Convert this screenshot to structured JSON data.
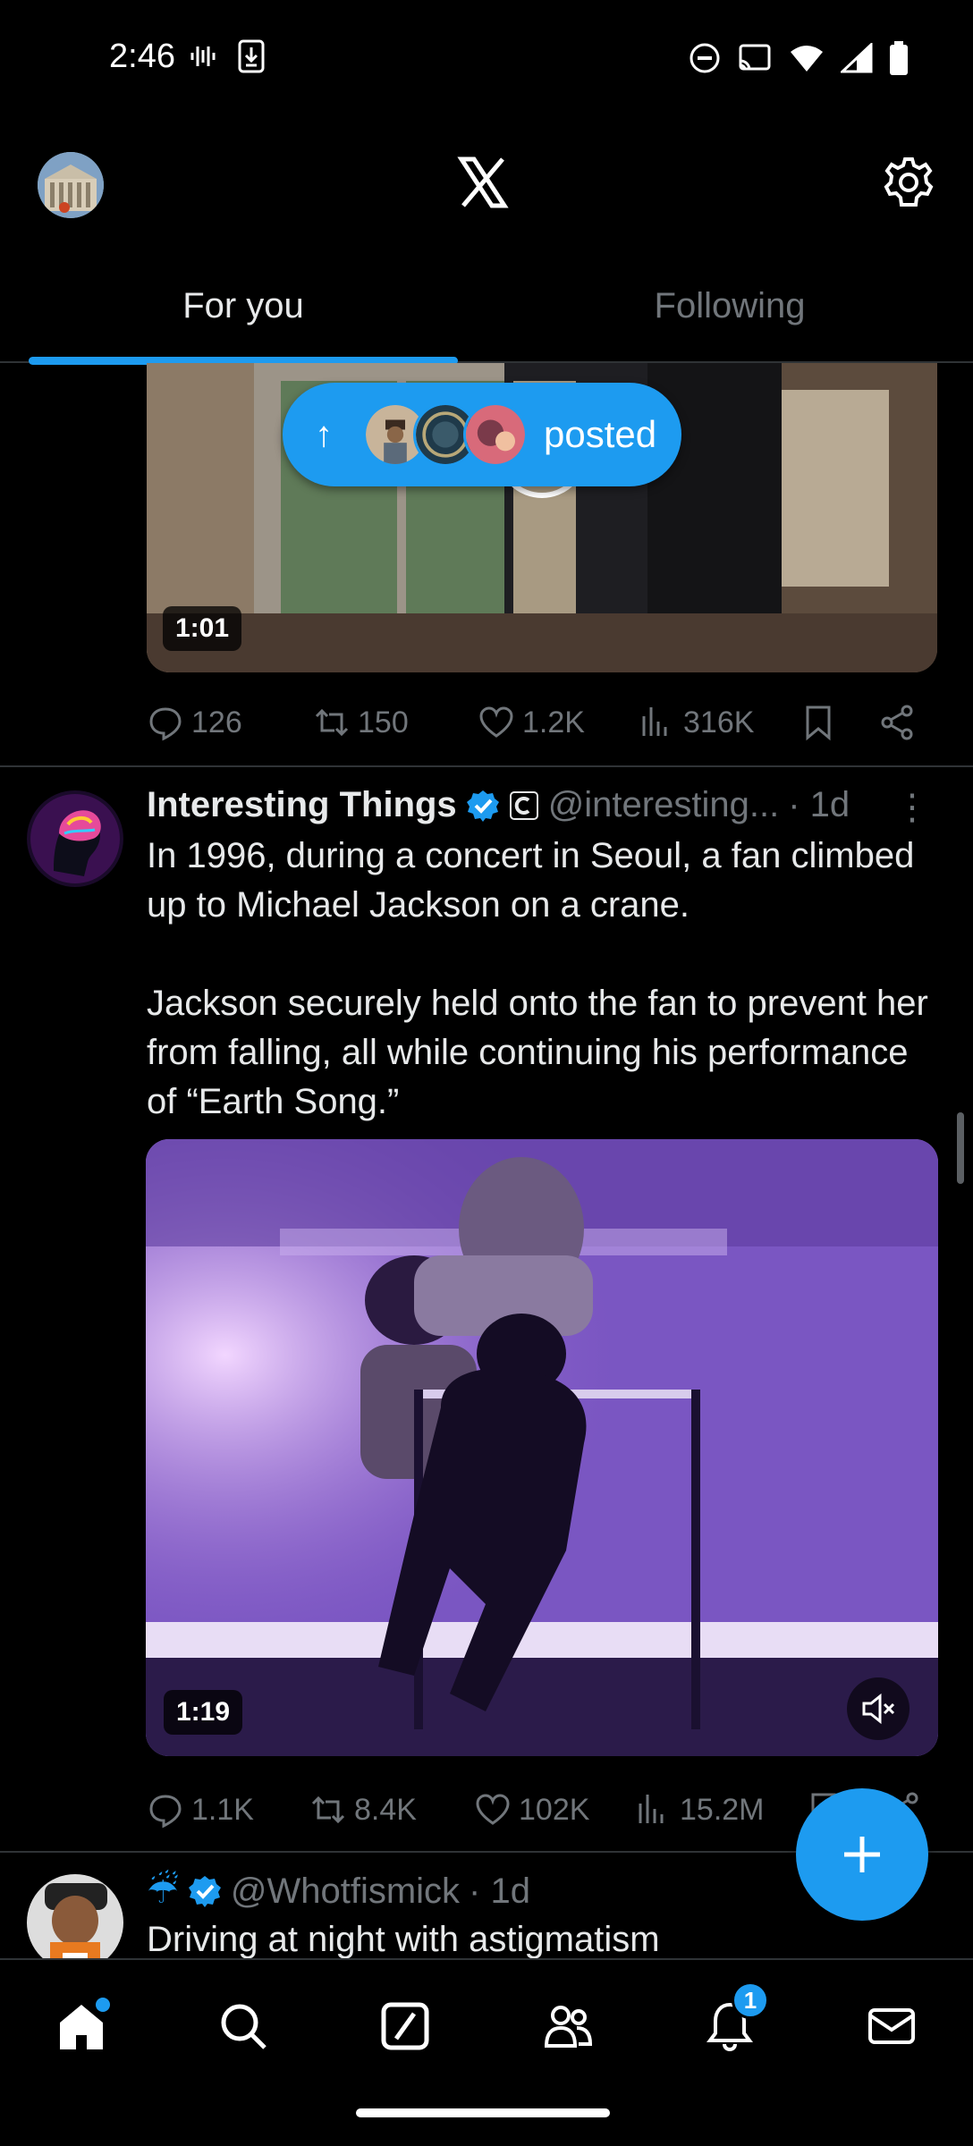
{
  "status_bar": {
    "time": "2:46"
  },
  "header": {
    "app": "X"
  },
  "tabs": [
    {
      "label": "For you",
      "active": true
    },
    {
      "label": "Following",
      "active": false
    }
  ],
  "new_posts_pill": {
    "label": "posted"
  },
  "post1": {
    "video_duration": "1:01",
    "replies": "126",
    "reposts": "150",
    "likes": "1.2K",
    "views": "316K"
  },
  "post2": {
    "name": "Interesting Things",
    "handle": "@interesting...",
    "time": "· 1d",
    "text": "In 1996, during a concert in Seoul, a fan climbed up to Michael Jackson on a crane.\n\nJackson securely held onto the fan to prevent her from falling, all while continuing his performance of “Earth Song.”",
    "video_duration": "1:19",
    "replies": "1.1K",
    "reposts": "8.4K",
    "likes": "102K",
    "views": "15.2M"
  },
  "post3": {
    "name_emoji": "☔",
    "handle": "@Whotfismick",
    "time": "· 1d",
    "text": "Driving at night with astigmatism"
  },
  "bottom_nav": {
    "notifications_badge": "1"
  },
  "colors": {
    "accent": "#1d9bf0",
    "background": "#000000",
    "muted": "#71767b",
    "text": "#e7e9ea"
  }
}
